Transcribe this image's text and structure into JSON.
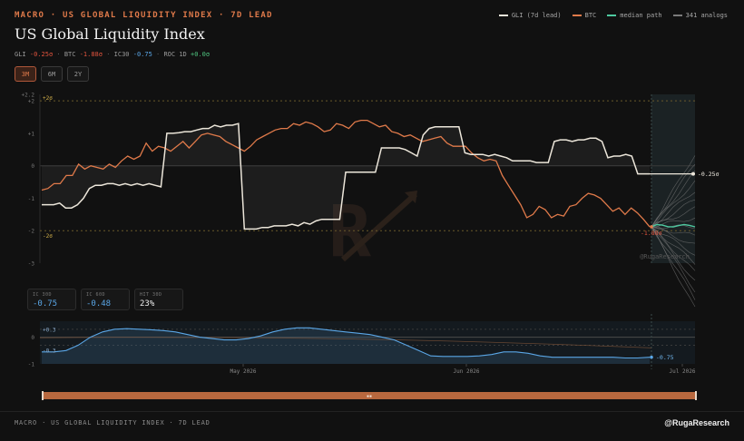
{
  "header": {
    "kicker": "MACRO · US GLOBAL LIQUIDITY INDEX · 7D LEAD",
    "title": "US Global Liquidity Index"
  },
  "stats": {
    "gli_label": "GLI",
    "gli_value": "-0.25σ",
    "btc_label": "BTC",
    "btc_value": "-1.88σ",
    "ic_label": "IC30",
    "ic_value": "-0.75",
    "roc_label": "ROC 1D",
    "roc_value": "+0.0σ",
    "sep": "·"
  },
  "legend": {
    "gli": "GLI (7d lead)",
    "btc": "BTC",
    "median": "median path",
    "analogs": "341 analogs"
  },
  "range_buttons": [
    "3M",
    "6M",
    "2Y"
  ],
  "cards": [
    {
      "label": "IC 30D",
      "value": "-0.75"
    },
    {
      "label": "IC 60D",
      "value": "-0.48"
    },
    {
      "label": "HIT 30D",
      "value": "23%"
    }
  ],
  "colors": {
    "gli": "#ece6da",
    "btc": "#e07a4a",
    "median": "#4ec9a0",
    "analogs": "#7a7a7a",
    "ic": "#5aa6e6",
    "accent": "#e07a4a"
  },
  "chart_data": [
    {
      "type": "line",
      "title": "US Global Liquidity Index",
      "ylim": [
        -3,
        2.2
      ],
      "y_ticks": [
        "+2.2",
        "+2",
        "+1",
        "0",
        "-1",
        "-2",
        "-3"
      ],
      "bands": {
        "upper_label": "+2σ",
        "lower_label": "-2σ",
        "upper": 2,
        "lower": -2
      },
      "end_labels": {
        "gli": "-0.25σ",
        "btc": "-1.88σ"
      },
      "watermark": "@RugaResearch",
      "series": [
        {
          "name": "GLI (7d lead)",
          "values": [
            -1.2,
            -1.2,
            -1.2,
            -1.15,
            -1.3,
            -1.3,
            -1.2,
            -1.0,
            -0.7,
            -0.6,
            -0.6,
            -0.55,
            -0.55,
            -0.6,
            -0.55,
            -0.6,
            -0.55,
            -0.6,
            -0.55,
            -0.6,
            -0.65,
            1.0,
            1.0,
            1.02,
            1.05,
            1.05,
            1.1,
            1.15,
            1.15,
            1.25,
            1.2,
            1.25,
            1.25,
            1.3,
            -1.95,
            -1.95,
            -1.95,
            -1.9,
            -1.9,
            -1.85,
            -1.85,
            -1.85,
            -1.8,
            -1.85,
            -1.75,
            -1.8,
            -1.7,
            -1.65,
            -1.65,
            -1.65,
            -1.65,
            -0.2,
            -0.2,
            -0.2,
            -0.2,
            -0.2,
            -0.2,
            0.55,
            0.55,
            0.55,
            0.55,
            0.5,
            0.4,
            0.3,
            0.95,
            1.15,
            1.2,
            1.2,
            1.2,
            1.2,
            1.2,
            0.4,
            0.35,
            0.35,
            0.35,
            0.3,
            0.35,
            0.3,
            0.25,
            0.15,
            0.15,
            0.15,
            0.15,
            0.1,
            0.1,
            0.1,
            0.75,
            0.8,
            0.8,
            0.75,
            0.8,
            0.8,
            0.85,
            0.85,
            0.75,
            0.25,
            0.3,
            0.3,
            0.35,
            0.3,
            -0.25,
            -0.25,
            -0.25
          ]
        },
        {
          "name": "BTC",
          "values": [
            -0.75,
            -0.7,
            -0.55,
            -0.55,
            -0.3,
            -0.3,
            0.05,
            -0.1,
            0.0,
            -0.05,
            -0.1,
            0.05,
            -0.05,
            0.15,
            0.3,
            0.2,
            0.3,
            0.7,
            0.45,
            0.6,
            0.55,
            0.45,
            0.6,
            0.75,
            0.55,
            0.75,
            0.95,
            1.0,
            0.95,
            0.9,
            0.75,
            0.65,
            0.55,
            0.45,
            0.6,
            0.8,
            0.9,
            1.0,
            1.1,
            1.15,
            1.15,
            1.3,
            1.25,
            1.35,
            1.3,
            1.2,
            1.05,
            1.1,
            1.3,
            1.25,
            1.15,
            1.35,
            1.4,
            1.4,
            1.3,
            1.2,
            1.25,
            1.05,
            1.0,
            0.9,
            0.95,
            0.85,
            0.75,
            0.8,
            0.85,
            0.9,
            0.7,
            0.6,
            0.6,
            0.6,
            0.4,
            0.25,
            0.15,
            0.2,
            0.15,
            -0.3,
            -0.6,
            -0.9,
            -1.2,
            -1.6,
            -1.5,
            -1.25,
            -1.35,
            -1.6,
            -1.5,
            -1.55,
            -1.25,
            -1.2,
            -1.0,
            -0.85,
            -0.9,
            -1.0,
            -1.2,
            -1.4,
            -1.3,
            -1.5,
            -1.3,
            -1.45,
            -1.65,
            -1.88
          ]
        }
      ],
      "forecast": {
        "median": -1.85,
        "analogs_count": 341
      }
    },
    {
      "type": "area",
      "title": "IC30",
      "ylim": [
        -1,
        0.6
      ],
      "y_ticks": [
        "+0.3",
        "0",
        "-0.3",
        "-1"
      ],
      "x_ticks": [
        "May 2026",
        "Jun 2026",
        "Jul 2026"
      ],
      "end_label": "-0.75",
      "series": [
        {
          "name": "IC30",
          "values": [
            -0.55,
            -0.55,
            -0.5,
            -0.3,
            0.0,
            0.2,
            0.3,
            0.32,
            0.3,
            0.28,
            0.25,
            0.2,
            0.1,
            0.0,
            -0.05,
            -0.1,
            -0.1,
            -0.05,
            0.05,
            0.2,
            0.3,
            0.35,
            0.35,
            0.3,
            0.25,
            0.2,
            0.15,
            0.1,
            0.0,
            -0.1,
            -0.3,
            -0.5,
            -0.7,
            -0.72,
            -0.72,
            -0.72,
            -0.7,
            -0.65,
            -0.55,
            -0.55,
            -0.6,
            -0.7,
            -0.75,
            -0.75,
            -0.75,
            -0.75,
            -0.75,
            -0.75,
            -0.78,
            -0.78,
            -0.75
          ]
        }
      ]
    }
  ]
}
